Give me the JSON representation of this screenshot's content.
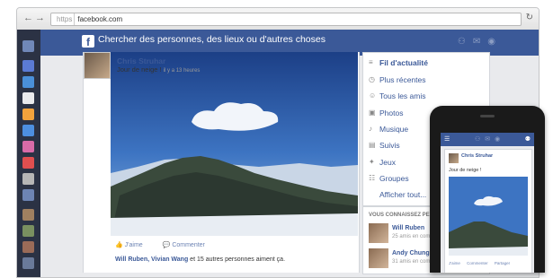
{
  "browser": {
    "url_proto": "https",
    "url": "facebook.com"
  },
  "fb": {
    "search_placeholder": "Chercher des personnes, des lieux ou d'autres choses"
  },
  "post": {
    "author": "Chris Struhar",
    "status": "Jour de neige !",
    "timestamp": "il y a 13 heures",
    "actions": [
      "J'aime",
      "Commenter"
    ],
    "likes_names": "Will Ruben, Vivian Wang",
    "likes_rest": " et 15 autres personnes aiment ça."
  },
  "menu": {
    "items": [
      {
        "label": "Fil d'actualité",
        "icon": "≡"
      },
      {
        "label": "Plus récentes",
        "icon": "◷"
      },
      {
        "label": "Tous les amis",
        "icon": "☺"
      },
      {
        "label": "Photos",
        "icon": "▣"
      },
      {
        "label": "Musique",
        "icon": "♪"
      },
      {
        "label": "Suivis",
        "icon": "▤"
      },
      {
        "label": "Jeux",
        "icon": "✦"
      },
      {
        "label": "Groupes",
        "icon": "☷"
      },
      {
        "label": "Afficher tout...",
        "icon": ""
      }
    ]
  },
  "suggest": {
    "heading": "VOUS CONNAISSEZ PEUT-ÊTRE",
    "people": [
      {
        "name": "Will Ruben",
        "sub": "25 amis en commun"
      },
      {
        "name": "Andy Chung",
        "sub": "31 amis en commun"
      }
    ]
  },
  "phone": {
    "author": "Chris Struhar",
    "status": "Jour de neige !",
    "actions": [
      "J'aime",
      "Commenter",
      "Partager"
    ]
  }
}
